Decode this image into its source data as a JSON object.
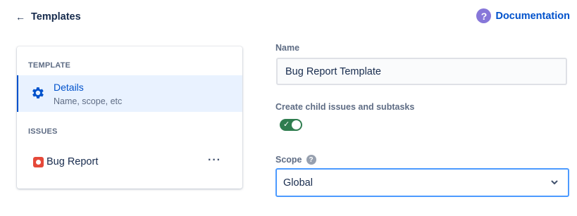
{
  "header": {
    "back_arrow": "←",
    "title": "Templates",
    "doc_icon": "?",
    "doc_link": "Documentation"
  },
  "sidebar": {
    "template_heading": "TEMPLATE",
    "details": {
      "title": "Details",
      "subtitle": "Name, scope, etc",
      "icon": "gear-icon"
    },
    "issues_heading": "ISSUES",
    "issues": [
      {
        "label": "Bug Report",
        "icon": "bug-icon",
        "more": "···"
      }
    ]
  },
  "form": {
    "name_label": "Name",
    "name_value": "Bug Report Template",
    "child_label": "Create child issues and subtasks",
    "child_enabled": true,
    "toggle_check": "✓",
    "scope_label": "Scope",
    "scope_help": "?",
    "scope_value": "Global"
  },
  "colors": {
    "accent": "#0052cc",
    "selected_bg": "#e9f2ff",
    "toggle_on": "#2f7d4f",
    "bug": "#e5493a",
    "help_purple": "#8777d9",
    "focus_border": "#4c9aff"
  }
}
